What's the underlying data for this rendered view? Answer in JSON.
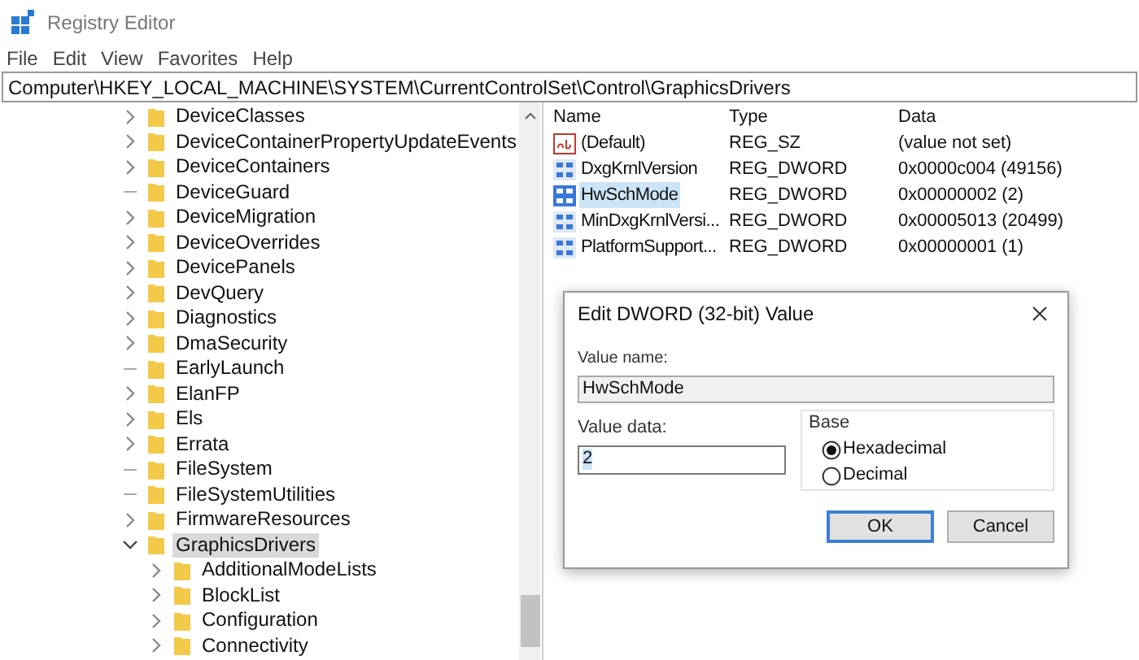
{
  "window": {
    "title": "Registry Editor"
  },
  "menu": [
    "File",
    "Edit",
    "View",
    "Favorites",
    "Help"
  ],
  "address": "Computer\\HKEY_LOCAL_MACHINE\\SYSTEM\\CurrentControlSet\\Control\\GraphicsDrivers",
  "tree": [
    {
      "label": "DeviceClasses",
      "kind": "branch",
      "expanded": false,
      "selected": false
    },
    {
      "label": "DeviceContainerPropertyUpdateEvents",
      "kind": "branch",
      "expanded": false,
      "selected": false
    },
    {
      "label": "DeviceContainers",
      "kind": "branch",
      "expanded": false,
      "selected": false
    },
    {
      "label": "DeviceGuard",
      "kind": "leaf",
      "selected": false
    },
    {
      "label": "DeviceMigration",
      "kind": "branch",
      "expanded": false,
      "selected": false
    },
    {
      "label": "DeviceOverrides",
      "kind": "branch",
      "expanded": false,
      "selected": false
    },
    {
      "label": "DevicePanels",
      "kind": "branch",
      "expanded": false,
      "selected": false
    },
    {
      "label": "DevQuery",
      "kind": "branch",
      "expanded": false,
      "selected": false
    },
    {
      "label": "Diagnostics",
      "kind": "branch",
      "expanded": false,
      "selected": false
    },
    {
      "label": "DmaSecurity",
      "kind": "branch",
      "expanded": false,
      "selected": false
    },
    {
      "label": "EarlyLaunch",
      "kind": "leaf",
      "selected": false
    },
    {
      "label": "ElanFP",
      "kind": "branch",
      "expanded": false,
      "selected": false
    },
    {
      "label": "Els",
      "kind": "branch",
      "expanded": false,
      "selected": false
    },
    {
      "label": "Errata",
      "kind": "branch",
      "expanded": false,
      "selected": false
    },
    {
      "label": "FileSystem",
      "kind": "leaf",
      "selected": false
    },
    {
      "label": "FileSystemUtilities",
      "kind": "leaf",
      "selected": false
    },
    {
      "label": "FirmwareResources",
      "kind": "branch",
      "expanded": false,
      "selected": false
    },
    {
      "label": "GraphicsDrivers",
      "kind": "branch",
      "expanded": true,
      "selected": true,
      "children": [
        {
          "label": "AdditionalModeLists",
          "kind": "branch",
          "expanded": false,
          "selected": false
        },
        {
          "label": "BlockList",
          "kind": "branch",
          "expanded": false,
          "selected": false
        },
        {
          "label": "Configuration",
          "kind": "branch",
          "expanded": false,
          "selected": false
        },
        {
          "label": "Connectivity",
          "kind": "branch",
          "expanded": false,
          "selected": false
        }
      ]
    }
  ],
  "values": {
    "columns": [
      "Name",
      "Type",
      "Data"
    ],
    "rows": [
      {
        "name": "(Default)",
        "type": "REG_SZ",
        "data": "(value not set)",
        "kind": "string",
        "selected": false
      },
      {
        "name": "DxgKrnlVersion",
        "type": "REG_DWORD",
        "data": "0x0000c004 (49156)",
        "kind": "dword",
        "selected": false
      },
      {
        "name": "HwSchMode",
        "type": "REG_DWORD",
        "data": "0x00000002 (2)",
        "kind": "dword",
        "selected": true
      },
      {
        "name": "MinDxgKrnlVersi...",
        "type": "REG_DWORD",
        "data": "0x00005013 (20499)",
        "kind": "dword",
        "selected": false
      },
      {
        "name": "PlatformSupport...",
        "type": "REG_DWORD",
        "data": "0x00000001 (1)",
        "kind": "dword",
        "selected": false
      }
    ]
  },
  "dialog": {
    "title": "Edit DWORD (32-bit) Value",
    "name_label": "Value name:",
    "name_value": "HwSchMode",
    "data_label": "Value data:",
    "data_value": "2",
    "base_label": "Base",
    "bases": [
      {
        "label": "Hexadecimal",
        "selected": true
      },
      {
        "label": "Decimal",
        "selected": false
      }
    ],
    "buttons": [
      "OK",
      "Cancel"
    ]
  }
}
